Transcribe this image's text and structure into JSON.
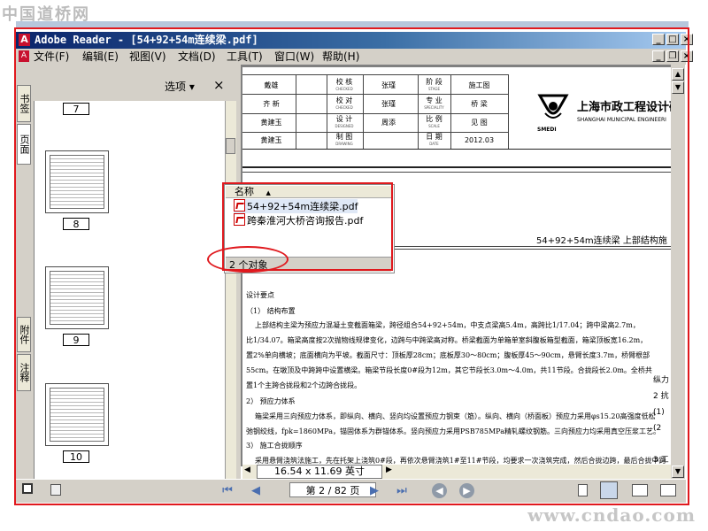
{
  "watermark": {
    "top": "中国道桥网",
    "bottom": "www.cndao.com"
  },
  "window": {
    "title": "Adobe Reader - [54+92+54m连续梁.pdf]",
    "logo_icon": "adobe-reader-icon",
    "title_buttons": [
      "minimize-icon",
      "maximize-icon",
      "close-icon"
    ],
    "doc_buttons": [
      "minimize-icon",
      "restore-icon",
      "close-icon"
    ]
  },
  "menu": {
    "items": [
      "文件(F)",
      "编辑(E)",
      "视图(V)",
      "文档(D)",
      "工具(T)",
      "窗口(W)",
      "帮助(H)"
    ]
  },
  "sidebar": {
    "tabs": [
      "书签",
      "页面",
      "附件",
      "注释"
    ],
    "options_label": "选项 ▾",
    "close_label": "×",
    "pages": [
      "7",
      "8",
      "9",
      "10"
    ]
  },
  "explorer": {
    "column_header": "名称",
    "files": [
      "54+92+54m连续梁.pdf",
      "跨秦淮河大桥咨询报告.pdf"
    ],
    "status": "2 个对象"
  },
  "document": {
    "header_rows": [
      {
        "c1": "戴雄",
        "c2a": "校 核",
        "c2b": "CHECKED",
        "c3": "张瑾",
        "c4a": "阶 段",
        "c4b": "STAGE",
        "c5": "施工图"
      },
      {
        "c1": "齐 新",
        "c2a": "校 对",
        "c2b": "CHECKED",
        "c3": "张瑾",
        "c4a": "专 业",
        "c4b": "SPECIALITY",
        "c5": "桥 梁"
      },
      {
        "c1": "黄建玉",
        "c2a": "设 计",
        "c2b": "DESIGNED",
        "c3": "周添",
        "c4a": "比 例",
        "c4b": "SCALE",
        "c5": "见 图"
      },
      {
        "c1": "黄建玉",
        "c2a": "制 图",
        "c2b": "DRAWING",
        "c3": "",
        "c4a": "日 期",
        "c4b": "DATE",
        "c5": "2012.03"
      }
    ],
    "company_name": "上海市政工程设计研",
    "company_name_en": "SHANGHAI MUNICIPAL ENGINEERI",
    "company_abbr": "SMEDI",
    "drawing_title": "54+92+54m连续梁   上部结构施",
    "side_notes": [
      "纵力",
      "2 抗",
      "(1)",
      "(2",
      "3 工"
    ],
    "body_lines": [
      "设计要点",
      "（1） 结构布置",
      "上部结构主梁为预应力混凝土变截面箱梁，跨径组合54+92+54m，中支点梁高5.4m，高跨比1/17.04；跨中梁高2.7m，",
      "比1/34.07。箱梁高度按2次抛物线规律变化，边跨与中跨梁高对称。桥梁截面为单箱单室斜腹板箱型截面，箱梁顶板宽16.2m，",
      "置2%单向横坡；底面横向为平坡。截面尺寸：顶板厚28cm；底板厚30～80cm；腹板厚45～90cm，悬臂长度3.7m，桥臂根部",
      "55cm。在墩顶及中跨跨中设置横梁。箱梁节段长度0#段为12m，其它节段长3.0m～4.0m，共11节段。合拢段长2.0m。全桥共",
      "置1个主跨合拢段和2个边跨合拢段。",
      "2） 预应力体系",
      "箱梁采用三向预应力体系，即纵向、横向、竖向均设置预应力钢束（筋）。纵向、横向（桥面板）预应力采用φs15.20高强度低松",
      "弛钢绞线，fpk=1860MPa，锚固体系为群锚体系。竖向预应力采用PSB785MPa精轧螺纹钢筋。三向预应力均采用真空压浆工艺。",
      "3） 施工合拢顺序",
      "采用悬臂浇筑法施工，先在托架上浇筑0#段，再依次悬臂浇筑1#至11#节段，均要求一次浇筑完成，然后合拢边跨，最后合拢中跨"
    ],
    "size_label": "16.54 x 11.69 英寸"
  },
  "toolbar": {
    "page_field": "第 2 / 82 页",
    "nav_icons": [
      "first-page-icon",
      "previous-page-icon",
      "next-page-icon",
      "last-page-icon"
    ],
    "history_icons": [
      "back-icon",
      "forward-icon"
    ],
    "layout_icons": [
      "single-page-icon",
      "continuous-icon",
      "facing-icon",
      "continuous-facing-icon"
    ]
  },
  "colors": {
    "annotation_red": "#e0191e",
    "title_dark": "#0a246a",
    "ui_gray": "#d4d0c8"
  }
}
